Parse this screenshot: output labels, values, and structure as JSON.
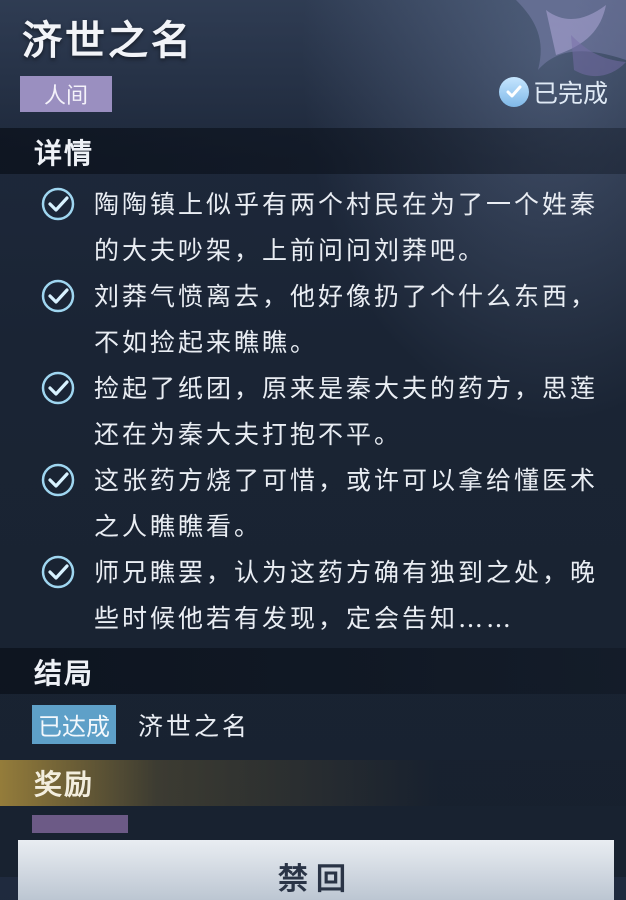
{
  "header": {
    "title": "济世之名",
    "tag": "人间",
    "status": "已完成"
  },
  "details": {
    "heading": "详情",
    "items": [
      {
        "text": "陶陶镇上似乎有两个村民在为了一个姓秦的大夫吵架，上前问问刘莽吧。"
      },
      {
        "text": "刘莽气愤离去，他好像扔了个什么东西，不如捡起来瞧瞧。"
      },
      {
        "text": "捡起了纸团，原来是秦大夫的药方，思莲还在为秦大夫打抱不平。"
      },
      {
        "text": "这张药方烧了可惜，或许可以拿给懂医术之人瞧瞧看。"
      },
      {
        "text": "师兄瞧罢，认为这药方确有独到之处，晚些时候他若有发现，定会告知……"
      }
    ]
  },
  "ending": {
    "heading": "结局",
    "badge": "已达成",
    "name": "济世之名"
  },
  "reward": {
    "heading": "奖励"
  },
  "footer": {
    "button": "禁回"
  },
  "colors": {
    "tag_bg": "#9a8fc0",
    "achieved_bg": "#5ea0c8",
    "check": "#9fd6f0"
  },
  "icons": {
    "status": "check-circle-icon",
    "item": "check-circle-icon",
    "decoration": "butterfly-wing-icon"
  }
}
